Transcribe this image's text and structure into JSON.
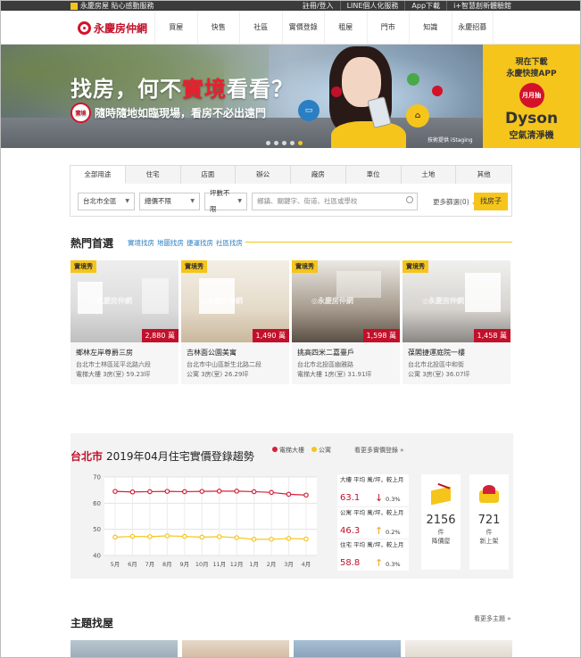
{
  "topbar": {
    "brand": "永慶房屋 貼心感動服務",
    "links": [
      "註冊/登入",
      "LINE個人化服務",
      "App下載",
      "i+智慧創新體驗館"
    ]
  },
  "nav": {
    "logo": "永慶房仲網",
    "items": [
      "買屋",
      "快售",
      "社區",
      "實價登錄",
      "租屋",
      "門市",
      "知識",
      "永慶招募"
    ]
  },
  "banner": {
    "headline_pre": "找房，何不",
    "headline_red": "實境",
    "headline_post": "看看？",
    "icon_label": "實境",
    "subline": "隨時隨地如臨現場，看房不必出遠門",
    "credit": "技術提供 iStaging",
    "promo_line1": "現在下載",
    "promo_line2": "永慶快搜APP",
    "promo_badge": "月月抽",
    "promo_brand": "Dyson",
    "promo_product": "空氣清淨機",
    "accent": "#f5c51b",
    "brand_red": "#c3102a"
  },
  "search": {
    "tabs": [
      "全部用途",
      "住宅",
      "店面",
      "辦公",
      "廠房",
      "車位",
      "土地",
      "其他"
    ],
    "active_tab": 0,
    "city": "台北市全區",
    "price": "總價不限",
    "area": "坪數不限",
    "keyword_placeholder": "鄉鎮、關鍵字、街道、社區或學校",
    "more_filters": "更多篩選(0)",
    "button": "找房子"
  },
  "hot": {
    "title": "熱門首選",
    "links": [
      "實境找房",
      "地圖找房",
      "捷運找房",
      "社區找房"
    ],
    "watermark": "◎永慶房仲網",
    "cards": [
      {
        "badge": "實境秀",
        "price": "2,880 萬",
        "title": "鄉林左岸尊爵三房",
        "address": "台北市士林區延平北路六段",
        "detail": "電梯大樓  3房(室)  59.23坪"
      },
      {
        "badge": "實境秀",
        "price": "1,490 萬",
        "title": "吉林面公園美寓",
        "address": "台北市中山區新生北路二段",
        "detail": "公寓  3房(室)  26.29坪"
      },
      {
        "badge": "實境秀",
        "price": "1,598 萬",
        "title": "挑高四米二嘉臺戶",
        "address": "台北市北投區幽雅路",
        "detail": "電梯大樓  1房(室)  31.91坪"
      },
      {
        "badge": "實境秀",
        "price": "1,458 萬",
        "title": "葆閣捷運庭院一樓",
        "address": "台北市北投區中和街",
        "detail": "公寓  3房(室)  36.07坪"
      }
    ]
  },
  "trend": {
    "city": "台北市",
    "title": "2019年04月住宅實價登錄趨勢",
    "legend": [
      "電梯大樓",
      "公寓"
    ],
    "more": "看更多實價登錄 »",
    "stats": [
      {
        "label": "大樓 平均 萬/坪，較上月",
        "value": "63.1",
        "dir": "down",
        "pct": "0.3%"
      },
      {
        "label": "公寓 平均 萬/坪，較上月",
        "value": "46.3",
        "dir": "up",
        "pct": "0.2%"
      },
      {
        "label": "住宅 平均 萬/坪，較上月",
        "value": "58.8",
        "dir": "up",
        "pct": "0.3%"
      }
    ],
    "price_drop_count": "2156",
    "price_drop_unit": "件",
    "price_drop_label": "降價屋",
    "new_count": "721",
    "new_unit": "件",
    "new_label": "新上架"
  },
  "chart_data": {
    "type": "line",
    "categories": [
      "5月",
      "6月",
      "7月",
      "8月",
      "9月",
      "10月",
      "11月",
      "12月",
      "1月",
      "2月",
      "3月",
      "4月"
    ],
    "series": [
      {
        "name": "電梯大樓",
        "color": "#d4213a",
        "values": [
          64.5,
          64.3,
          64.4,
          64.5,
          64.4,
          64.5,
          64.6,
          64.6,
          64.4,
          64.1,
          63.4,
          63.1
        ]
      },
      {
        "name": "公寓",
        "color": "#f5c51b",
        "values": [
          47.0,
          47.3,
          47.2,
          47.5,
          47.3,
          47.0,
          47.2,
          46.8,
          46.2,
          46.2,
          46.5,
          46.3
        ]
      }
    ],
    "yticks": [
      "70",
      "60",
      "50",
      "40"
    ],
    "ylim": [
      40,
      70
    ],
    "grid": true
  },
  "theme": {
    "title": "主題找屋",
    "more": "看更多主題 »"
  }
}
